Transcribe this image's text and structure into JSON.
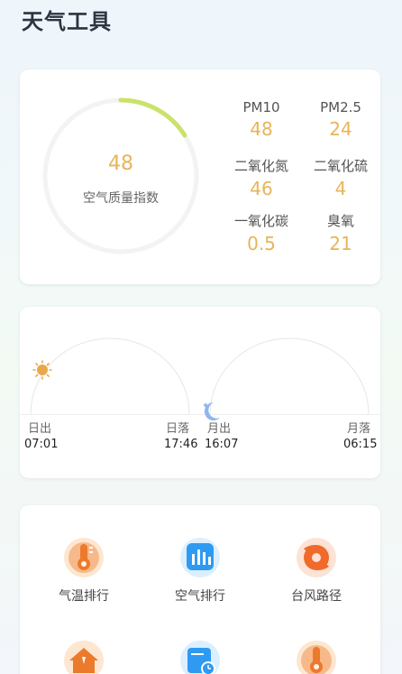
{
  "page": {
    "title": "天气工具"
  },
  "aqi": {
    "value": "48",
    "label": "空气质量指数",
    "fraction": 0.16,
    "ring_color": "#c9e36a",
    "track_color": "#f3f3f3",
    "value_color": "#e8b45a",
    "pollutants": [
      {
        "name": "PM10",
        "value": "48"
      },
      {
        "name": "PM2.5",
        "value": "24"
      },
      {
        "name": "二氧化氮",
        "value": "46"
      },
      {
        "name": "二氧化硫",
        "value": "4"
      },
      {
        "name": "一氧化碳",
        "value": "0.5"
      },
      {
        "name": "臭氧",
        "value": "21"
      }
    ]
  },
  "sun_moon": {
    "sunrise_label": "日出",
    "sunrise_time": "07:01",
    "sunset_label": "日落",
    "sunset_time": "17:46",
    "moonrise_label": "月出",
    "moonrise_time": "16:07",
    "moonset_label": "月落",
    "moonset_time": "06:15",
    "sun_icon": "sun-icon",
    "moon_icon": "moon-icon"
  },
  "tools": [
    {
      "label": "气温排行",
      "icon": "thermometer-icon"
    },
    {
      "label": "空气排行",
      "icon": "bar-chart-icon"
    },
    {
      "label": "台风路径",
      "icon": "typhoon-icon"
    },
    {
      "label": "",
      "icon": "house-alert-icon"
    },
    {
      "label": "",
      "icon": "clock-calendar-icon"
    },
    {
      "label": "",
      "icon": "thermometer-icon"
    }
  ]
}
